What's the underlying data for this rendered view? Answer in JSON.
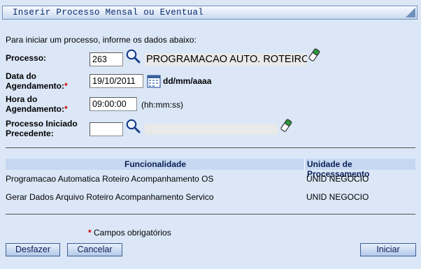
{
  "header": {
    "title": "Inserir Processo Mensal ou Eventual"
  },
  "intro": "Para iniciar um processo, informe os dados abaixo:",
  "form": {
    "processo": {
      "label": "Processo:",
      "value": "263",
      "name": "PROGRAMACAO AUTO. ROTEIRO AC"
    },
    "data": {
      "label_line1": "Data do",
      "label_line2": "Agendamento:",
      "required": "*",
      "value": "19/10/2011",
      "format": "dd/mm/aaaa"
    },
    "hora": {
      "label_line1": "Hora do",
      "label_line2": "Agendamento:",
      "required": "*",
      "value": "09:00:00",
      "format": "(hh:mm:ss)"
    },
    "precedente": {
      "label_line1": "Processo Iniciado",
      "label_line2": "Precedente:",
      "value": "",
      "name": ""
    }
  },
  "table": {
    "columns": [
      "Funcionalidade",
      "Unidade de Processamento"
    ],
    "rows": [
      [
        "Programacao Automatica Roteiro Acompanhamento OS",
        "UNID NEGOCIO"
      ],
      [
        "Gerar Dados Arquivo Roteiro Acompanhamento Servico",
        "UNID NEGOCIO"
      ]
    ]
  },
  "required_note": {
    "star": "*",
    "text": " Campos obrigatórios"
  },
  "buttons": {
    "desfazer": "Desfazer",
    "cancelar": "Cancelar",
    "iniciar": "Iniciar"
  },
  "icons": [
    "search-icon",
    "eraser-icon",
    "calendar-icon"
  ],
  "colors": {
    "background": "#dbe7f7",
    "title_text": "#0a2a6e",
    "required": "#d60000",
    "table_header": "#c6d8f1"
  }
}
